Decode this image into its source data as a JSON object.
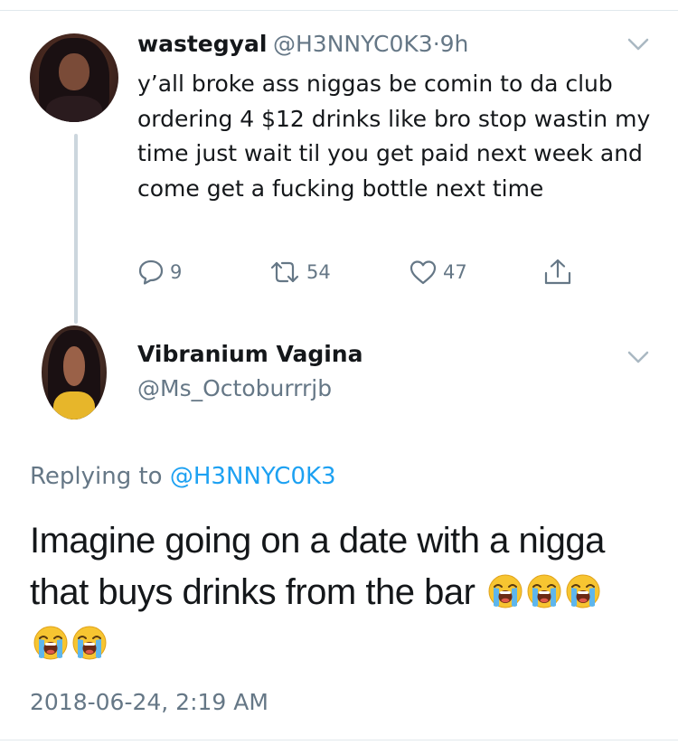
{
  "original_tweet": {
    "author_name": "wastegyal",
    "author_handle": "@H3NNYC0K3",
    "separator": "·",
    "time_ago": "9h",
    "text": "y’all broke ass niggas be comin to da club ordering 4 $12 drinks like bro stop wastin my time just wait til you get paid next week and come get a fucking bottle next time",
    "actions": {
      "replies": "9",
      "retweets": "54",
      "likes": "47"
    }
  },
  "reply_tweet": {
    "author_name": "Vibranium Vagina",
    "author_handle": "@Ms_Octoburrrjb",
    "replying_to_label": "Replying to",
    "replying_to_handle": "@H3NNYC0K3",
    "text_line1": "Imagine going on a date with a nigga",
    "text_line2": "that buys drinks from the bar",
    "emoji_name": "loudly-crying-face",
    "emoji_count": 5,
    "timestamp": "2018-06-24, 2:19 AM"
  },
  "colors": {
    "primary_text": "#14171a",
    "secondary_text": "#657786",
    "link": "#1da1f2",
    "divider": "#e1e8ed",
    "thread_line": "#ccd6dd"
  },
  "icons": [
    "chevron-down-icon",
    "reply-icon",
    "retweet-icon",
    "like-icon",
    "share-icon",
    "loudly-crying-face-emoji"
  ]
}
